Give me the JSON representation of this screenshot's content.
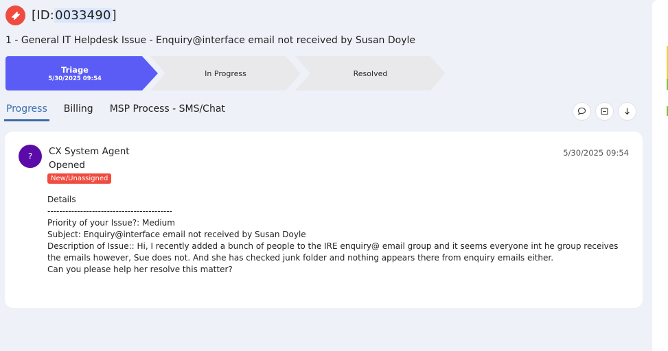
{
  "ticket": {
    "id_prefix": "[ID:",
    "id_number": "0033490",
    "id_suffix": "]",
    "subject_line": "1 - General IT Helpdesk Issue - Enquiry@interface email not received by Susan Doyle"
  },
  "stages": [
    {
      "name": "Triage",
      "date": "5/30/2025 09:54",
      "active": true
    },
    {
      "name": "In Progress",
      "active": false
    },
    {
      "name": "Resolved",
      "active": false
    }
  ],
  "tabs": [
    {
      "label": "Progress",
      "active": true
    },
    {
      "label": "Billing",
      "active": false
    },
    {
      "label": "MSP Process - SMS/Chat",
      "active": false
    }
  ],
  "actions": [
    {
      "icon": "comment-icon"
    },
    {
      "icon": "collapse-icon"
    },
    {
      "icon": "arrow-down-icon"
    }
  ],
  "entry": {
    "avatar_initial": "?",
    "author": "CX System Agent",
    "action": "Opened",
    "status": "New/Unassigned",
    "timestamp": "5/30/2025 09:54",
    "details_lines": [
      "Details",
      "------------------------------------------",
      "Priority of your Issue?: Medium",
      "Subject: Enquiry@interface email not received by Susan Doyle",
      "Description of Issue:: Hi, I recently added a bunch of people to the IRE enquiry@ email group and it seems everyone int he group receives the emails however, Sue does not. And she has checked junk folder and nothing appears there from enquiry emails either.",
      "Can you please help her resolve this matter?"
    ]
  },
  "colors": {
    "accent": "#5b5bf6",
    "brand_red": "#ef4b3f",
    "avatar": "#5a0ba8",
    "tab_active": "#3a6fb0"
  }
}
